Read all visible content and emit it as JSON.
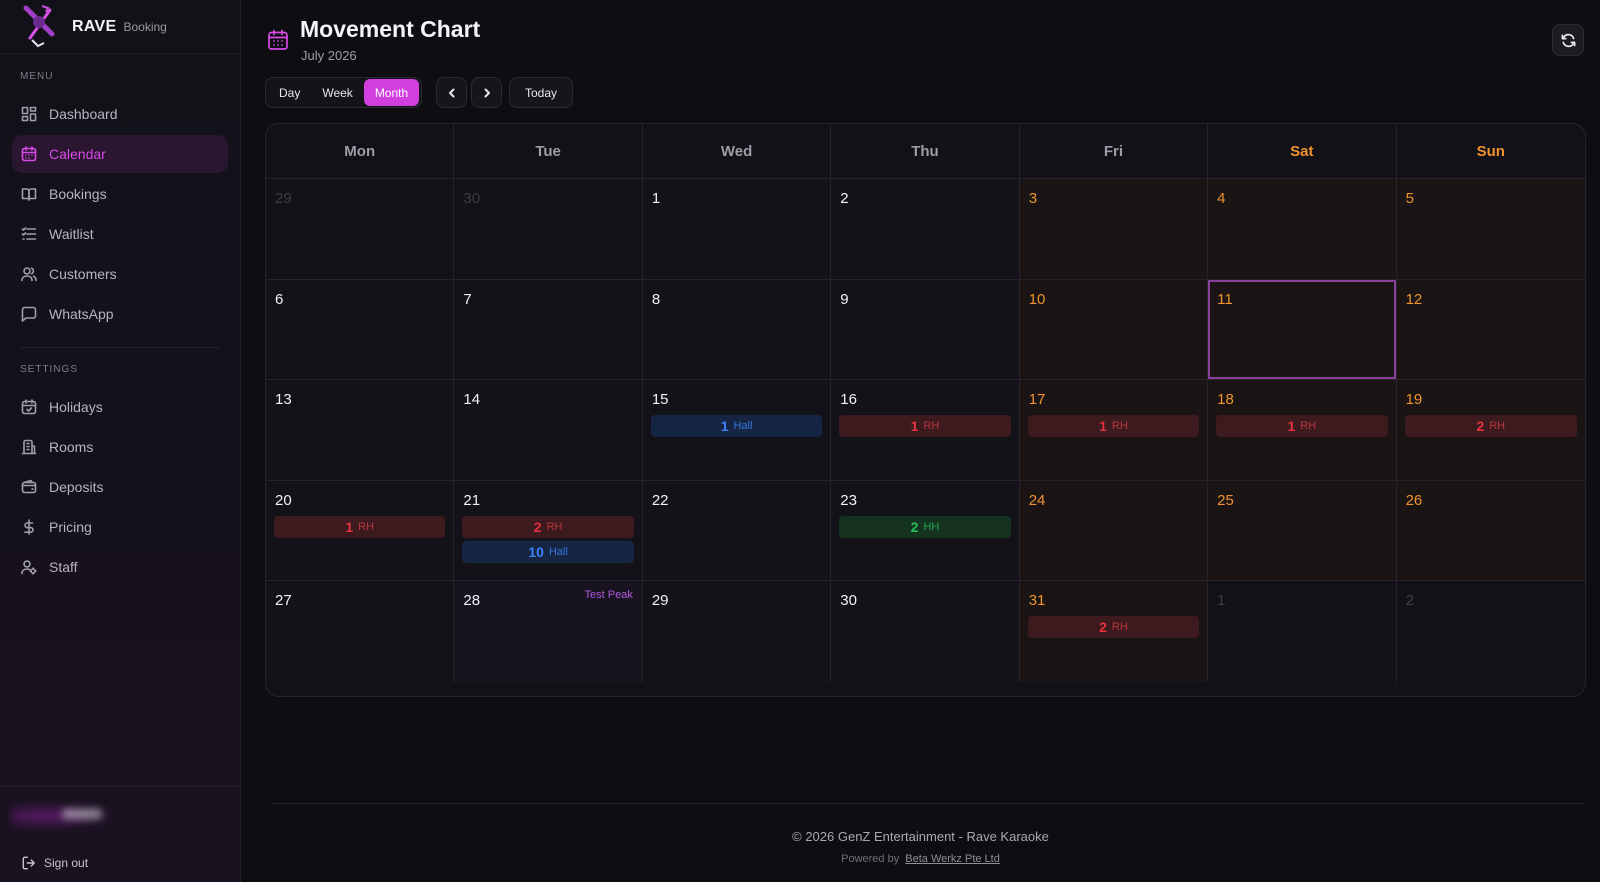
{
  "brand": {
    "name": "RAVE",
    "sub": "Booking"
  },
  "sidebar": {
    "menu_label": "MENU",
    "menu": [
      {
        "label": "Dashboard",
        "icon": "dashboard-icon",
        "active": false
      },
      {
        "label": "Calendar",
        "icon": "calendar-icon",
        "active": true
      },
      {
        "label": "Bookings",
        "icon": "book-icon",
        "active": false
      },
      {
        "label": "Waitlist",
        "icon": "list-icon",
        "active": false
      },
      {
        "label": "Customers",
        "icon": "users-icon",
        "active": false
      },
      {
        "label": "WhatsApp",
        "icon": "chat-icon",
        "active": false
      }
    ],
    "settings_label": "SETTINGS",
    "settings": [
      {
        "label": "Holidays",
        "icon": "calendar-check-icon"
      },
      {
        "label": "Rooms",
        "icon": "building-icon"
      },
      {
        "label": "Deposits",
        "icon": "wallet-icon"
      },
      {
        "label": "Pricing",
        "icon": "dollar-icon"
      },
      {
        "label": "Staff",
        "icon": "user-settings-icon"
      }
    ],
    "signout_label": "Sign out"
  },
  "header": {
    "title": "Movement Chart",
    "subtitle": "July 2026",
    "views": [
      "Day",
      "Week",
      "Month"
    ],
    "active_view": "Month",
    "today_label": "Today"
  },
  "calendar": {
    "weekdays": [
      "Mon",
      "Tue",
      "Wed",
      "Thu",
      "Fri",
      "Sat",
      "Sun"
    ],
    "weekend_days": [
      "Fri",
      "Sat",
      "Sun"
    ],
    "weeks": [
      [
        {
          "day": "29",
          "outside": true,
          "badges": []
        },
        {
          "day": "30",
          "outside": true,
          "badges": []
        },
        {
          "day": "1",
          "badges": []
        },
        {
          "day": "2",
          "badges": []
        },
        {
          "day": "3",
          "weekend": true,
          "badges": []
        },
        {
          "day": "4",
          "weekend": true,
          "badges": []
        },
        {
          "day": "5",
          "weekend": true,
          "badges": []
        }
      ],
      [
        {
          "day": "6",
          "badges": []
        },
        {
          "day": "7",
          "badges": []
        },
        {
          "day": "8",
          "badges": []
        },
        {
          "day": "9",
          "badges": []
        },
        {
          "day": "10",
          "weekend": true,
          "badges": []
        },
        {
          "day": "11",
          "weekend": true,
          "selected": true,
          "badges": []
        },
        {
          "day": "12",
          "weekend": true,
          "badges": []
        }
      ],
      [
        {
          "day": "13",
          "badges": []
        },
        {
          "day": "14",
          "badges": []
        },
        {
          "day": "15",
          "badges": [
            {
              "count": "1",
              "label": "Hall",
              "type": "hall"
            }
          ]
        },
        {
          "day": "16",
          "badges": [
            {
              "count": "1",
              "label": "RH",
              "type": "rh"
            }
          ]
        },
        {
          "day": "17",
          "weekend": true,
          "badges": [
            {
              "count": "1",
              "label": "RH",
              "type": "rh"
            }
          ]
        },
        {
          "day": "18",
          "weekend": true,
          "badges": [
            {
              "count": "1",
              "label": "RH",
              "type": "rh"
            }
          ]
        },
        {
          "day": "19",
          "weekend": true,
          "badges": [
            {
              "count": "2",
              "label": "RH",
              "type": "rh"
            }
          ]
        }
      ],
      [
        {
          "day": "20",
          "badges": [
            {
              "count": "1",
              "label": "RH",
              "type": "rh"
            }
          ]
        },
        {
          "day": "21",
          "badges": [
            {
              "count": "2",
              "label": "RH",
              "type": "rh"
            },
            {
              "count": "10",
              "label": "Hall",
              "type": "hall"
            }
          ]
        },
        {
          "day": "22",
          "badges": []
        },
        {
          "day": "23",
          "badges": [
            {
              "count": "2",
              "label": "HH",
              "type": "hh"
            }
          ]
        },
        {
          "day": "24",
          "weekend": true,
          "badges": []
        },
        {
          "day": "25",
          "weekend": true,
          "badges": []
        },
        {
          "day": "26",
          "weekend": true,
          "badges": []
        }
      ],
      [
        {
          "day": "27",
          "badges": []
        },
        {
          "day": "28",
          "peak": "Test Peak",
          "badges": []
        },
        {
          "day": "29",
          "badges": []
        },
        {
          "day": "30",
          "badges": []
        },
        {
          "day": "31",
          "weekend": true,
          "badges": [
            {
              "count": "2",
              "label": "RH",
              "type": "rh"
            }
          ]
        },
        {
          "day": "1",
          "outside": true,
          "badges": []
        },
        {
          "day": "2",
          "outside": true,
          "badges": []
        }
      ]
    ]
  },
  "footer": {
    "copyright": "© 2026 GenZ Entertainment - Rave Karaoke",
    "powered_prefix": "Powered by",
    "powered_link": "Beta Werkz Pte Ltd"
  },
  "colors": {
    "accent": "#d13fdf",
    "weekend": "#f0922e",
    "rh": "#e5323e",
    "hall": "#3d82f5",
    "hh": "#25c25a"
  }
}
